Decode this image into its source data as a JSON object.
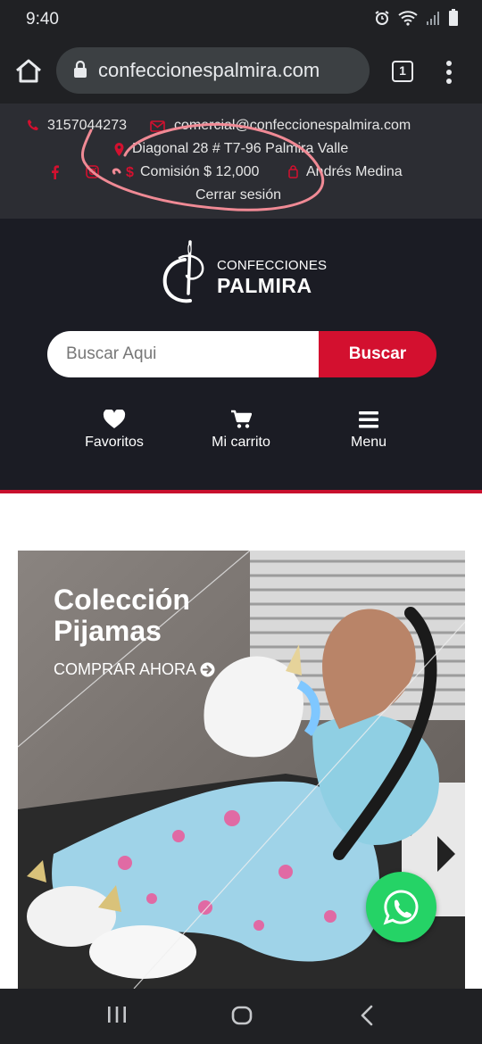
{
  "status_bar": {
    "time": "9:40"
  },
  "browser": {
    "url": "confeccionespalmira.com",
    "tab_count": "1"
  },
  "topbar": {
    "phone": "3157044273",
    "email": "comercial@confeccionespalmira.com",
    "address": "Diagonal 28 # T7-96 Palmira Valle",
    "commission": "Comisión $ 12,000",
    "user": "Andrés Medina",
    "logout": "Cerrar sesión",
    "accent_color": "#d3102f"
  },
  "header": {
    "logo_line1": "CONFECCIONES",
    "logo_line2": "PALMIRA",
    "search_placeholder": "Buscar Aqui",
    "search_button": "Buscar",
    "nav": {
      "favorites": "Favoritos",
      "cart": "Mi carrito",
      "menu": "Menu"
    }
  },
  "hero": {
    "title": "Colección Pijamas",
    "cta": "COMPRAR AHORA"
  },
  "icons": [
    "home-icon",
    "lock-icon",
    "tabs-icon",
    "more-icon",
    "phone-icon",
    "mail-icon",
    "map-pin-icon",
    "facebook-icon",
    "instagram-icon",
    "dollar-icon",
    "user-icon",
    "heart-icon",
    "cart-icon",
    "menu-icon",
    "arrow-right-circle-icon",
    "whatsapp-icon",
    "recents-icon",
    "home-circle-icon",
    "back-icon"
  ]
}
